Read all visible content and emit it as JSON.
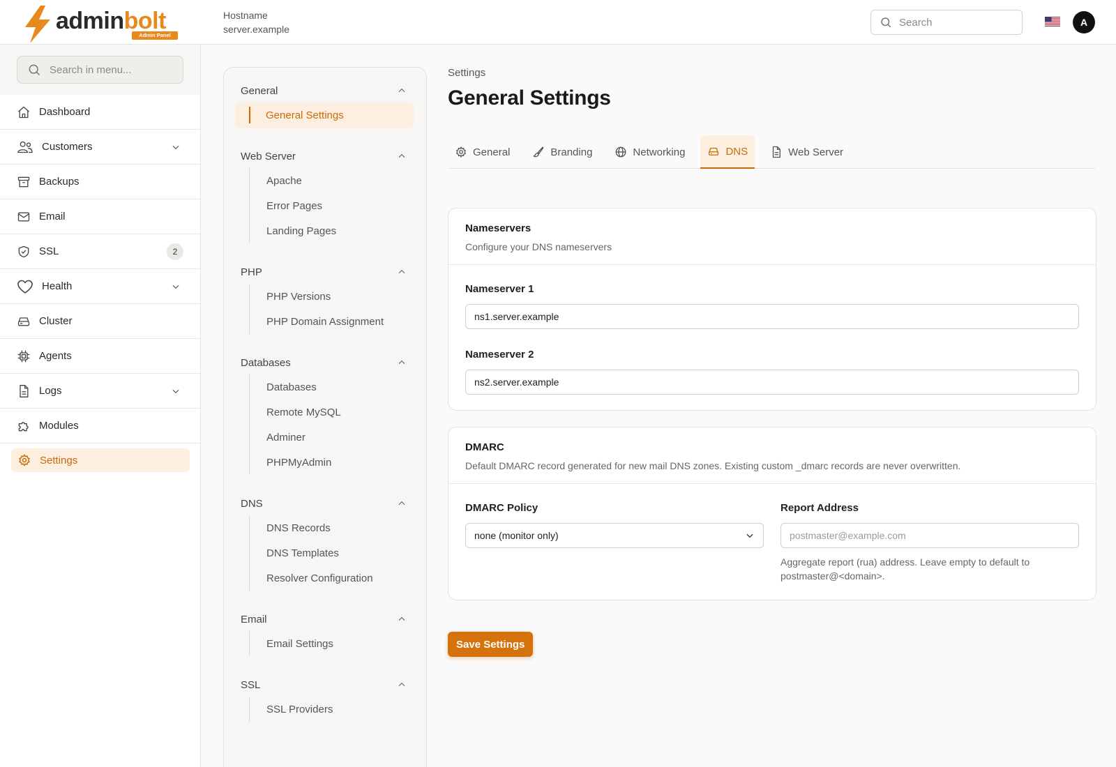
{
  "brand": {
    "word_dark": "admin",
    "word_accent": "bolt",
    "badge": "Admin Panel",
    "accent_color": "#e8891d"
  },
  "header": {
    "hostname_label": "Hostname",
    "hostname_value": "server.example",
    "search_placeholder": "Search",
    "flag_icon": "us-flag-icon",
    "avatar_initial": "A"
  },
  "sidebar": {
    "search_placeholder": "Search in menu...",
    "items": [
      {
        "label": "Dashboard",
        "icon": "home-icon"
      },
      {
        "label": "Customers",
        "icon": "users-icon",
        "expandable": true
      },
      {
        "label": "Backups",
        "icon": "archive-icon"
      },
      {
        "label": "Email",
        "icon": "mail-icon"
      },
      {
        "label": "SSL",
        "icon": "shield-check-icon",
        "badge": "2"
      },
      {
        "label": "Health",
        "icon": "heart-icon",
        "expandable": true
      },
      {
        "label": "Cluster",
        "icon": "server-icon"
      },
      {
        "label": "Agents",
        "icon": "cpu-icon"
      },
      {
        "label": "Logs",
        "icon": "file-icon",
        "expandable": true
      },
      {
        "label": "Modules",
        "icon": "puzzle-icon"
      },
      {
        "label": "Settings",
        "icon": "gear-icon",
        "active": true
      }
    ]
  },
  "subnav": {
    "groups": [
      {
        "title": "General",
        "items": [
          "General Settings"
        ]
      },
      {
        "title": "Web Server",
        "items": [
          "Apache",
          "Error Pages",
          "Landing Pages"
        ]
      },
      {
        "title": "PHP",
        "items": [
          "PHP Versions",
          "PHP Domain Assignment"
        ]
      },
      {
        "title": "Databases",
        "items": [
          "Databases",
          "Remote MySQL",
          "Adminer",
          "PHPMyAdmin"
        ]
      },
      {
        "title": "DNS",
        "items": [
          "DNS Records",
          "DNS Templates",
          "Resolver Configuration"
        ]
      },
      {
        "title": "Email",
        "items": [
          "Email Settings"
        ]
      },
      {
        "title": "SSL",
        "items": [
          "SSL Providers"
        ]
      }
    ]
  },
  "main": {
    "breadcrumb": "Settings",
    "title": "General Settings",
    "tabs": [
      {
        "label": "General",
        "icon": "gear-icon"
      },
      {
        "label": "Branding",
        "icon": "brush-icon"
      },
      {
        "label": "Networking",
        "icon": "globe-icon"
      },
      {
        "label": "DNS",
        "icon": "hard-drive-icon",
        "active": true
      },
      {
        "label": "Web Server",
        "icon": "document-icon"
      }
    ],
    "nameservers": {
      "title": "Nameservers",
      "description": "Configure your DNS nameservers",
      "ns1_label": "Nameserver 1",
      "ns1_value": "ns1.server.example",
      "ns2_label": "Nameserver 2",
      "ns2_value": "ns2.server.example"
    },
    "dmarc": {
      "title": "DMARC",
      "description": "Default DMARC record generated for new mail DNS zones. Existing custom _dmarc records are never overwritten.",
      "policy_label": "DMARC Policy",
      "policy_value": "none (monitor only)",
      "report_label": "Report Address",
      "report_placeholder": "postmaster@example.com",
      "report_value": "",
      "report_help": "Aggregate report (rua) address. Leave empty to default to postmaster@<domain>."
    },
    "save_label": "Save Settings"
  }
}
